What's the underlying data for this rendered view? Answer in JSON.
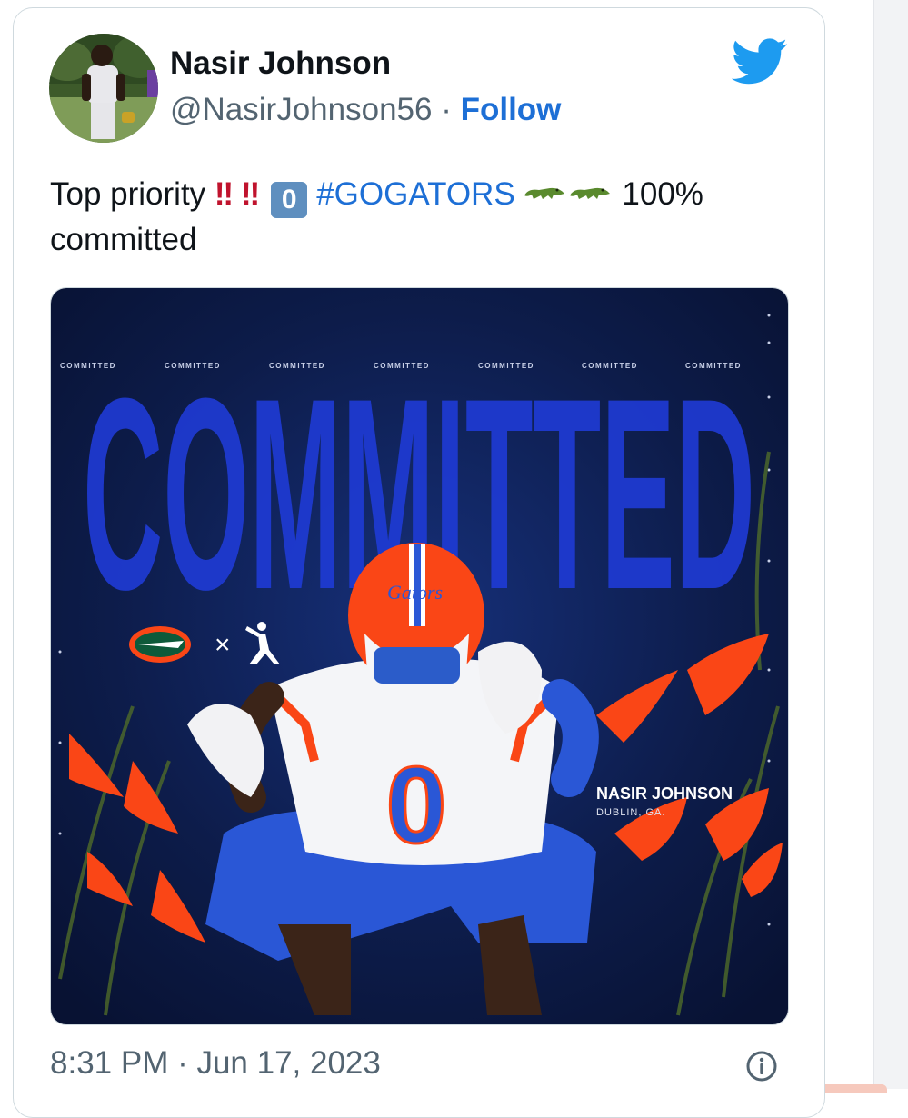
{
  "tweet": {
    "author_name": "Nasir Johnson",
    "handle": "@NasirJohnson56",
    "separator": "·",
    "follow_label": "Follow",
    "text": {
      "prefix": "Top priority",
      "bang1": "‼",
      "bang2": "‼",
      "keycap": "0",
      "hashtag": "#GOGATORS",
      "suffix": "100%",
      "line2": "committed"
    },
    "timestamp": "8:31 PM · Jun 17, 2023",
    "icons": {
      "logo": "twitter-bird-icon",
      "info": "info-circle-icon",
      "emoji": "crocodile-emoji-icon"
    },
    "colors": {
      "link": "#1d6fd6",
      "twitter_blue": "#1d9bf0",
      "bang_red": "#c0132d",
      "muted": "#536471"
    }
  },
  "media": {
    "graphic_banner": "COMMITTED",
    "graphic_repeat_label": "COMMITTED",
    "player_first_name": "NASIR",
    "player_last_name": "JOHNSON",
    "player_location": "DUBLIN, GA.",
    "cross_symbol": "×",
    "jersey_number": "0",
    "helmet_text": "Gators",
    "colors": {
      "background": "#0b1a3e",
      "accent_blue": "#1f3bd6",
      "accent_orange": "#fa4616"
    }
  }
}
